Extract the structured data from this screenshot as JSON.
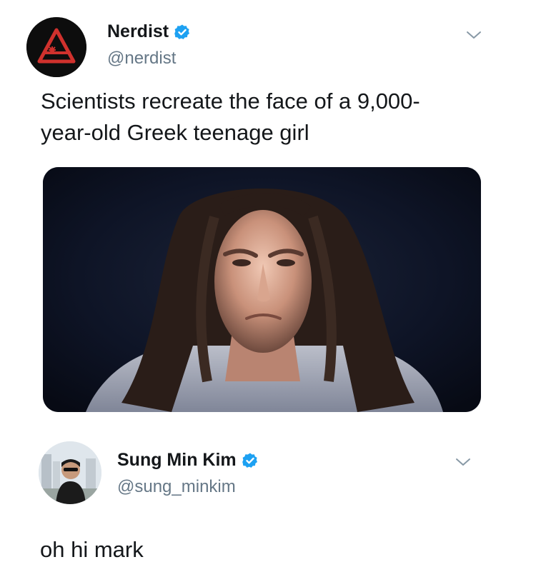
{
  "tweet1": {
    "author": {
      "display_name": "Nerdist",
      "handle": "@nerdist",
      "verified": true,
      "avatar": "nerdist-logo-avatar"
    },
    "menu_icon": "chevron-down-icon",
    "text": "Scientists recreate the face of a 9,000-year-old Greek teenage girl",
    "text_lines": [
      "Scientists recreate the face of a 9,000-",
      "year-old Greek teenage girl"
    ],
    "media": {
      "kind": "photo",
      "icon": "reconstructed-face-photo"
    }
  },
  "tweet2": {
    "author": {
      "display_name": "Sung Min Kim",
      "handle": "@sung_minkim",
      "verified": true,
      "avatar": "profile-photo-avatar"
    },
    "menu_icon": "chevron-down-icon",
    "text": "oh hi mark"
  },
  "colors": {
    "text_primary": "#14171a",
    "text_secondary": "#657786",
    "verified_blue": "#1da1f2",
    "nerdist_red": "#d0312d",
    "background": "#ffffff"
  }
}
